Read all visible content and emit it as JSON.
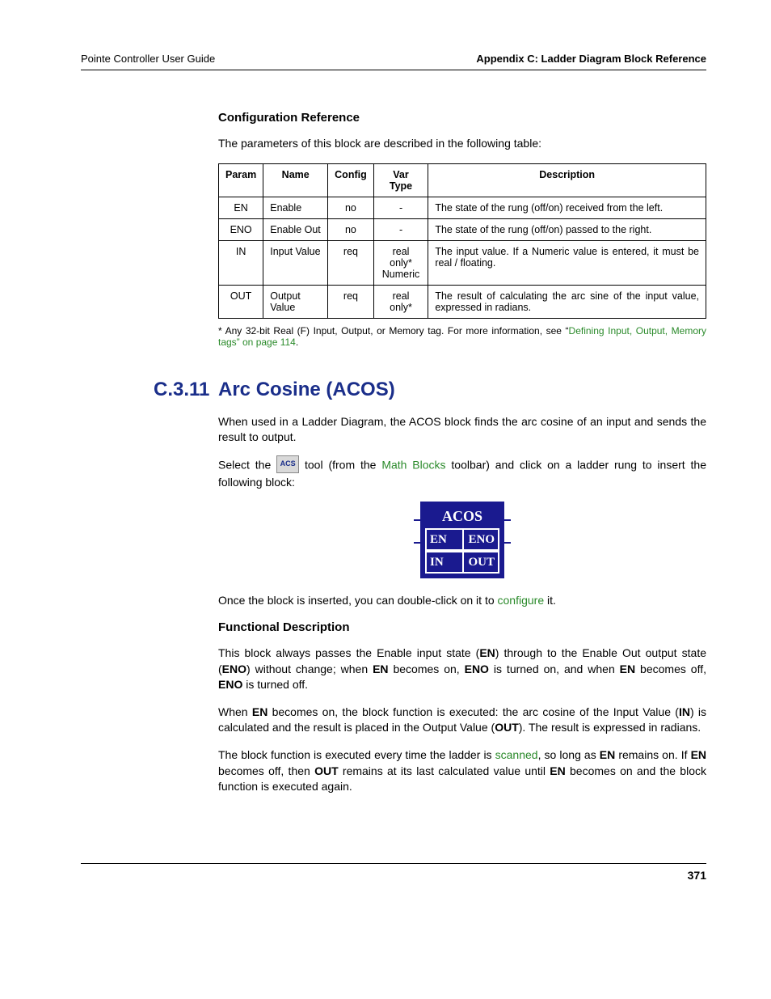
{
  "header": {
    "left": "Pointe Controller User Guide",
    "right": "Appendix C: Ladder Diagram Block Reference"
  },
  "configRef": {
    "heading": "Configuration Reference",
    "intro": "The parameters of this block are described in the following table:",
    "cols": {
      "param": "Param",
      "name": "Name",
      "config": "Config",
      "vartype": "Var Type",
      "desc": "Description"
    },
    "rows": [
      {
        "param": "EN",
        "name": "Enable",
        "config": "no",
        "vartype": "-",
        "desc": "The state of the rung (off/on) received from the left."
      },
      {
        "param": "ENO",
        "name": "Enable Out",
        "config": "no",
        "vartype": "-",
        "desc": "The state of the rung (off/on) passed to the right."
      },
      {
        "param": "IN",
        "name": "Input Value",
        "config": "req",
        "vartype": "real only*\nNumeric",
        "desc": "The input value. If a Numeric value is entered, it must be real / floating."
      },
      {
        "param": "OUT",
        "name": "Output Value",
        "config": "req",
        "vartype": "real only*",
        "desc": "The result of calculating the arc sine of the input value, expressed in radians."
      }
    ],
    "footnote_prefix": "* Any 32-bit Real (F) Input, Output, or Memory tag. For more information, see “",
    "footnote_link": "Defining Input, Output, Memory tags” on page 114",
    "footnote_suffix": "."
  },
  "section": {
    "number": "C.3.11",
    "title": "Arc Cosine (ACOS)",
    "p1": "When used in a Ladder Diagram, the ACOS block finds the arc cosine of an input and sends the result to output.",
    "p2a": "Select the ",
    "tool_label": "ACS",
    "p2b": " tool (from the ",
    "p2_link": "Math Blocks",
    "p2c": " toolbar) and click on a ladder rung to insert the following block:",
    "block": {
      "title": "ACOS",
      "tl": "EN",
      "tr": "ENO",
      "bl": "IN",
      "br": "OUT"
    },
    "p3a": "Once the block is inserted, you can double-click on it to ",
    "p3_link": "configure",
    "p3b": " it."
  },
  "functional": {
    "heading": "Functional Description",
    "p1_parts": [
      "This block always passes the Enable input state (",
      "EN",
      ") through to the Enable Out output state (",
      "ENO",
      ") without change; when ",
      "EN",
      " becomes on, ",
      "ENO",
      " is turned on, and when ",
      "EN",
      " becomes off, ",
      "ENO",
      " is turned off."
    ],
    "p2_parts": [
      "When ",
      "EN",
      " becomes on, the block function is executed: the arc cosine of the Input Value (",
      "IN",
      ") is calculated and the result is placed in the Output Value (",
      "OUT",
      "). The result is expressed in radians."
    ],
    "p3a": "The block function is executed every time the ladder is ",
    "p3_link": "scanned",
    "p3b": ", so long as ",
    "p3c": " remains on. If ",
    "p3d": " becomes off, then ",
    "p3e": " remains at its last calculated value until ",
    "p3f": " becomes on and the block function is executed again.",
    "b1": "EN",
    "b2": "EN",
    "b3": "OUT",
    "b4": "EN"
  },
  "pageNumber": "371"
}
